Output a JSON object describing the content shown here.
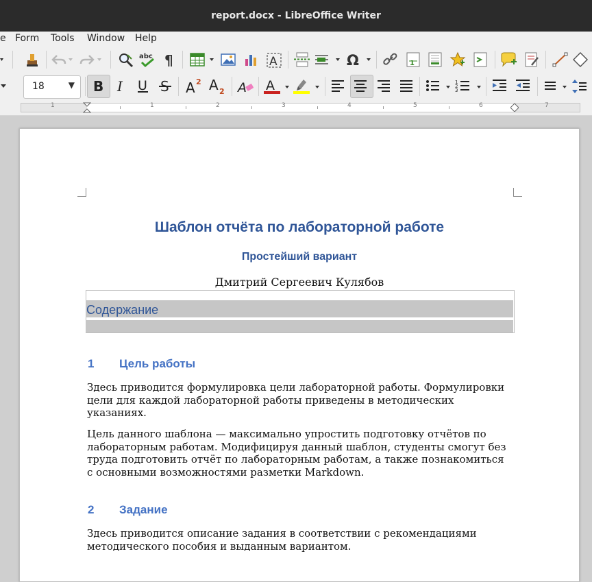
{
  "window": {
    "title": "report.docx - LibreOffice Writer"
  },
  "menubar": {
    "items": [
      "e",
      "Form",
      "Tools",
      "Window",
      "Help"
    ]
  },
  "toolbar": {
    "font_size": "18"
  },
  "ruler": {
    "numbers": [
      "1",
      "1",
      "2",
      "3",
      "4",
      "5",
      "6",
      "7"
    ]
  },
  "document": {
    "title": "Шаблон отчёта по лабораторной работе",
    "subtitle": "Простейший вариант",
    "author": "Дмитрий Сергеевич Кулябов",
    "toc_title": "Содержание",
    "sections": [
      {
        "number": "1",
        "heading": "Цель работы",
        "paragraphs": [
          "Здесь приводится формулировка цели лабораторной работы. Формулировки цели для каждой лабораторной работы приведены в методических указаниях.",
          "Цель данного шаблона — максимально упростить подготовку отчётов по лабораторным работам. Модифицируя данный шаблон, студенты смогут без труда подготовить отчёт по лабораторным работам, а также познакомиться с основными возможностями разметки Markdown."
        ]
      },
      {
        "number": "2",
        "heading": "Задание",
        "paragraphs": [
          "Здесь приводится описание задания в соответствии с рекомендациями методического пособия и выданным вариантом."
        ]
      }
    ]
  },
  "colors": {
    "heading": "#2f5597",
    "section_heading": "#4472c4",
    "titlebar": "#2b2b2b",
    "toc_band": "#c6c6c6"
  }
}
